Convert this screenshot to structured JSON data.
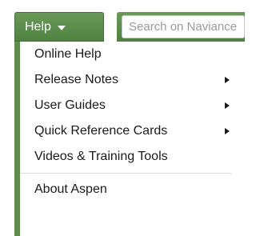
{
  "toolbar": {
    "help_label": "Help",
    "search_placeholder": "Search on Naviance",
    "accent_color": "#5d8c4c"
  },
  "help_menu": {
    "items": [
      {
        "label": "Online Help",
        "has_submenu": false
      },
      {
        "label": "Release Notes",
        "has_submenu": true
      },
      {
        "label": "User Guides",
        "has_submenu": true
      },
      {
        "label": "Quick Reference Cards",
        "has_submenu": true
      },
      {
        "label": "Videos & Training Tools",
        "has_submenu": false
      }
    ],
    "footer_item": {
      "label": "About Aspen"
    }
  }
}
